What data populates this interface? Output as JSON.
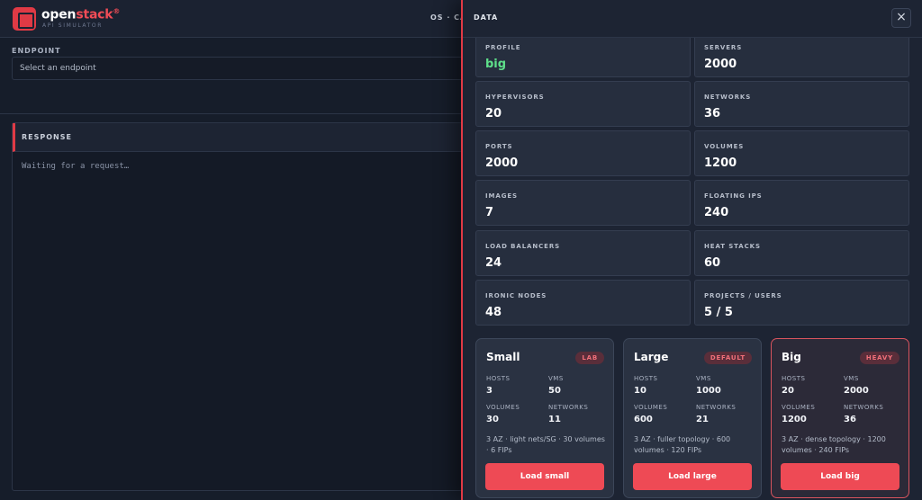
{
  "app": {
    "brand_main": "open",
    "brand_accent": "stack",
    "brand_mark": "®",
    "subtitle": "API SIMULATOR",
    "top_right_fragment": "OS · CA"
  },
  "endpoint": {
    "label": "ENDPOINT",
    "placeholder": "Select an endpoint"
  },
  "response": {
    "title": "RESPONSE",
    "body": "Waiting for a request…"
  },
  "drawer": {
    "title": "DATA",
    "close_label": "×",
    "stats": [
      {
        "label": "PROFILE",
        "value": "big"
      },
      {
        "label": "SERVERS",
        "value": "2000"
      },
      {
        "label": "HYPERVISORS",
        "value": "20"
      },
      {
        "label": "NETWORKS",
        "value": "36"
      },
      {
        "label": "PORTS",
        "value": "2000"
      },
      {
        "label": "VOLUMES",
        "value": "1200"
      },
      {
        "label": "IMAGES",
        "value": "7"
      },
      {
        "label": "FLOATING IPS",
        "value": "240"
      },
      {
        "label": "LOAD BALANCERS",
        "value": "24"
      },
      {
        "label": "HEAT STACKS",
        "value": "60"
      },
      {
        "label": "IRONIC NODES",
        "value": "48"
      },
      {
        "label": "PROJECTS / USERS",
        "value": "5 / 5"
      }
    ],
    "presets": [
      {
        "name": "Small",
        "badge": "LAB",
        "hosts_label": "HOSTS",
        "hosts": "3",
        "vms_label": "VMS",
        "vms": "50",
        "volumes_label": "VOLUMES",
        "volumes": "30",
        "networks_label": "NETWORKS",
        "networks": "11",
        "desc": "3 AZ · light nets/SG · 30 volumes · 6 FIPs",
        "button": "Load small"
      },
      {
        "name": "Large",
        "badge": "DEFAULT",
        "hosts_label": "HOSTS",
        "hosts": "10",
        "vms_label": "VMS",
        "vms": "1000",
        "volumes_label": "VOLUMES",
        "volumes": "600",
        "networks_label": "NETWORKS",
        "networks": "21",
        "desc": "3 AZ · fuller topology · 600 volumes · 120 FIPs",
        "button": "Load large"
      },
      {
        "name": "Big",
        "badge": "HEAVY",
        "hosts_label": "HOSTS",
        "hosts": "20",
        "vms_label": "VMS",
        "vms": "2000",
        "volumes_label": "VOLUMES",
        "volumes": "1200",
        "networks_label": "NETWORKS",
        "networks": "36",
        "desc": "3 AZ · dense topology · 1200 volumes · 240 FIPs",
        "button": "Load big"
      }
    ]
  },
  "colors": {
    "accent": "#e03a45",
    "button": "#ee4a55",
    "profile_value": "#5ee08a",
    "background": "#161d2a"
  }
}
